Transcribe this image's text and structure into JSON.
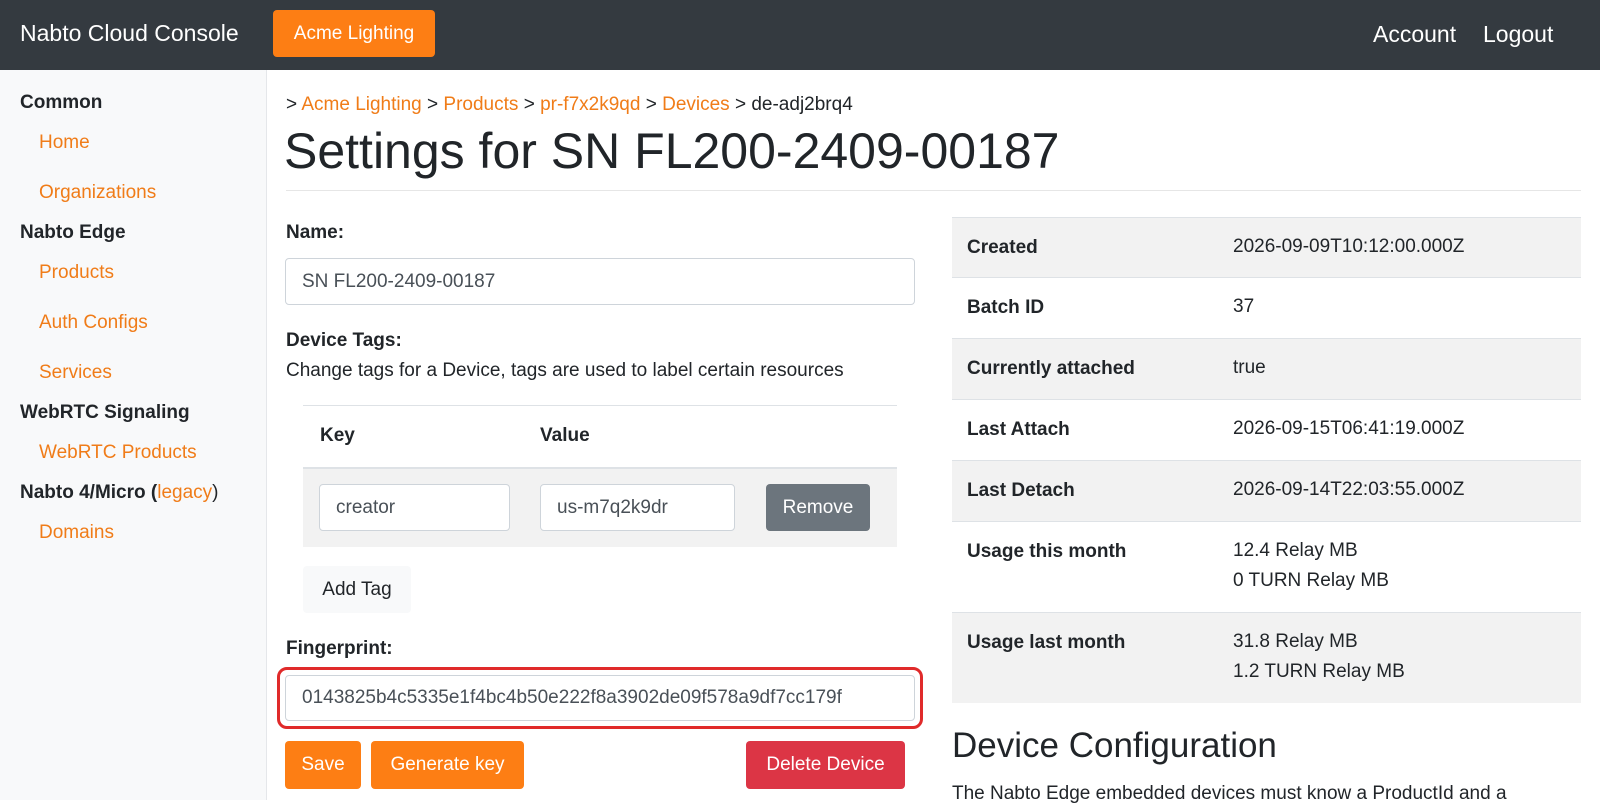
{
  "navbar": {
    "brand": "Nabto Cloud Console",
    "org_button": "Acme Lighting",
    "account": "Account",
    "logout": "Logout"
  },
  "sidebar": {
    "common": "Common",
    "home": "Home",
    "organizations": "Organizations",
    "nabto_edge": "Nabto Edge",
    "products": "Products",
    "auth_configs": "Auth Configs",
    "services": "Services",
    "webrtc_signaling": "WebRTC Signaling",
    "webrtc_products": "WebRTC Products",
    "nabto4_prefix": "Nabto 4/Micro (",
    "nabto4_legacy": "legacy",
    "nabto4_suffix": ")",
    "domains": "Domains"
  },
  "breadcrumb": {
    "sep": ">",
    "org": "Acme Lighting",
    "products": "Products",
    "product_id": "pr-f7x2k9qd",
    "devices": "Devices",
    "device_id": "de-adj2brq4"
  },
  "page": {
    "title": "Settings for SN FL200-2409-00187"
  },
  "form": {
    "name_label": "Name:",
    "name_value": "SN FL200-2409-00187",
    "tags_label": "Device Tags:",
    "tags_help": "Change tags for a Device, tags are used to label certain resources",
    "tag_table": {
      "key_header": "Key",
      "value_header": "Value",
      "rows": [
        {
          "key": "creator",
          "value": "us-m7q2k9dr",
          "remove": "Remove"
        }
      ]
    },
    "add_tag": "Add Tag",
    "fingerprint_label": "Fingerprint:",
    "fingerprint_value": "0143825b4c5335e1f4bc4b50e222f8a3902de09f578a9df7cc179f",
    "save": "Save",
    "generate_key": "Generate key",
    "delete_device": "Delete Device"
  },
  "info": {
    "created_key": "Created",
    "created_val": "2026-09-09T10:12:00.000Z",
    "batch_key": "Batch ID",
    "batch_val": "37",
    "attached_key": "Currently attached",
    "attached_val": "true",
    "last_attach_key": "Last Attach",
    "last_attach_val": "2026-09-15T06:41:19.000Z",
    "last_detach_key": "Last Detach",
    "last_detach_val": "2026-09-14T22:03:55.000Z",
    "usage_month_key": "Usage this month",
    "usage_month_relay": "12.4 Relay MB",
    "usage_month_turn": "0 TURN Relay MB",
    "usage_last_key": "Usage last month",
    "usage_last_relay": "31.8 Relay MB",
    "usage_last_turn": "1.2 TURN Relay MB"
  },
  "config": {
    "title": "Device Configuration",
    "text": "The Nabto Edge embedded devices must know a ProductId and a"
  },
  "colors": {
    "accent": "#fd7e14",
    "navbar": "#343a40",
    "danger": "#dc3545",
    "highlight": "#e02a2a"
  }
}
